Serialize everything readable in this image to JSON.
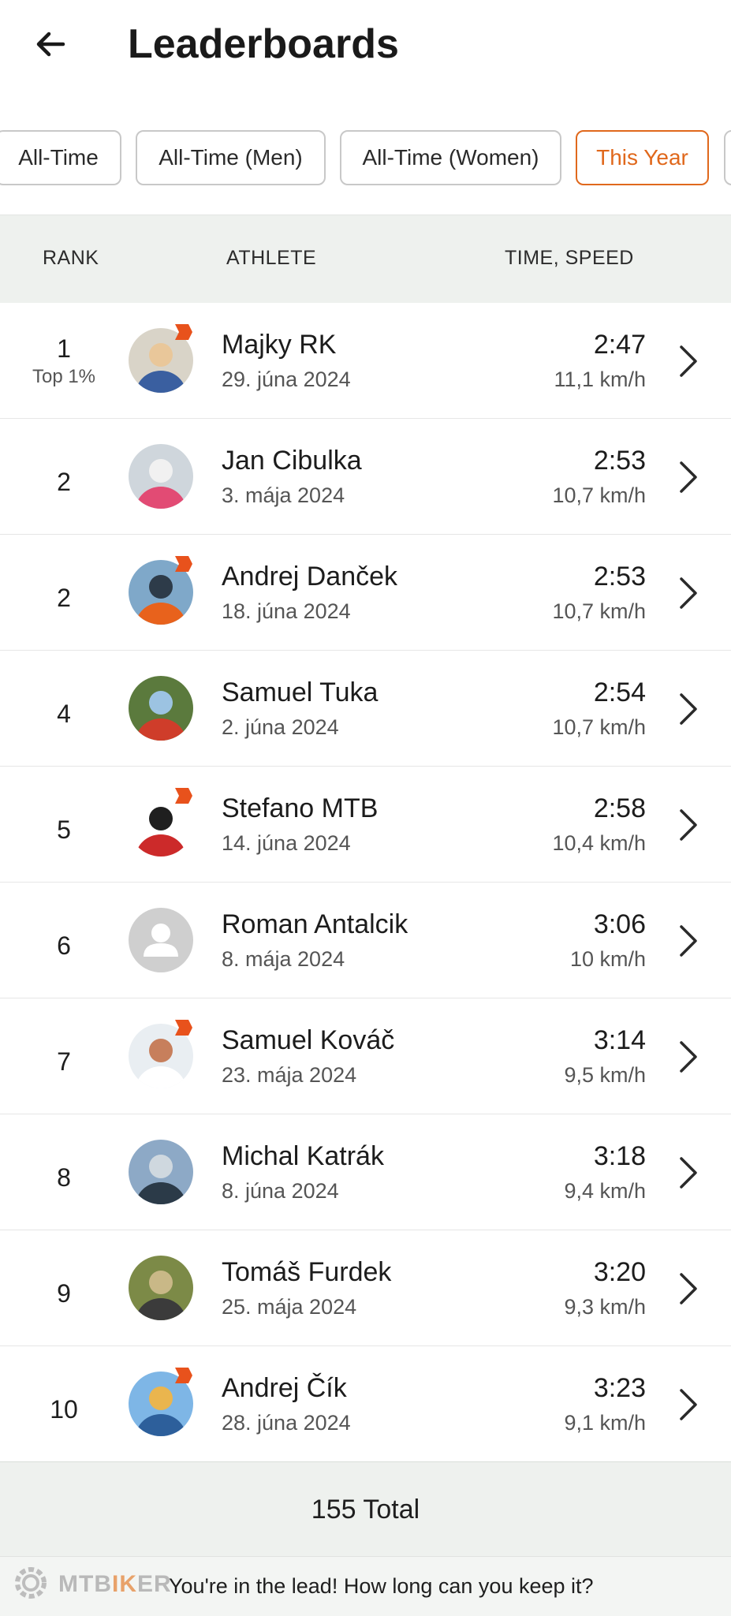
{
  "header": {
    "title": "Leaderboards",
    "back_icon": "arrow-left-icon"
  },
  "filters": [
    {
      "label": "All-Time",
      "active": false
    },
    {
      "label": "All-Time (Men)",
      "active": false
    },
    {
      "label": "All-Time (Women)",
      "active": false
    },
    {
      "label": "This Year",
      "active": true
    }
  ],
  "columns": {
    "rank": "RANK",
    "athlete": "ATHLETE",
    "time_speed": "TIME, SPEED"
  },
  "entries": [
    {
      "rank": "1",
      "rank_sub": "Top 1%",
      "name": "Majky RK",
      "date": "29. júna 2024",
      "time": "2:47",
      "speed": "11,1 km/h",
      "subscriber": true
    },
    {
      "rank": "2",
      "rank_sub": "",
      "name": "Jan Cibulka",
      "date": "3. mája 2024",
      "time": "2:53",
      "speed": "10,7 km/h",
      "subscriber": false
    },
    {
      "rank": "2",
      "rank_sub": "",
      "name": "Andrej Danček",
      "date": "18. júna 2024",
      "time": "2:53",
      "speed": "10,7 km/h",
      "subscriber": true
    },
    {
      "rank": "4",
      "rank_sub": "",
      "name": "Samuel Tuka",
      "date": "2. júna 2024",
      "time": "2:54",
      "speed": "10,7 km/h",
      "subscriber": false
    },
    {
      "rank": "5",
      "rank_sub": "",
      "name": "Stefano MTB",
      "date": "14. júna 2024",
      "time": "2:58",
      "speed": "10,4 km/h",
      "subscriber": true
    },
    {
      "rank": "6",
      "rank_sub": "",
      "name": "Roman Antalcik",
      "date": "8. mája 2024",
      "time": "3:06",
      "speed": "10 km/h",
      "subscriber": false
    },
    {
      "rank": "7",
      "rank_sub": "",
      "name": "Samuel Kováč",
      "date": "23. mája 2024",
      "time": "3:14",
      "speed": "9,5 km/h",
      "subscriber": true
    },
    {
      "rank": "8",
      "rank_sub": "",
      "name": "Michal Katrák",
      "date": "8. júna 2024",
      "time": "3:18",
      "speed": "9,4 km/h",
      "subscriber": false
    },
    {
      "rank": "9",
      "rank_sub": "",
      "name": "Tomáš Furdek",
      "date": "25. mája 2024",
      "time": "3:20",
      "speed": "9,3 km/h",
      "subscriber": false
    },
    {
      "rank": "10",
      "rank_sub": "",
      "name": "Andrej Čík",
      "date": "28. júna 2024",
      "time": "3:23",
      "speed": "9,1 km/h",
      "subscriber": true
    }
  ],
  "total": "155 Total",
  "footer": {
    "message": "You're in the lead!  How long can you keep it?",
    "watermark": "MTBIKER"
  },
  "colors": {
    "accent": "#e0681c",
    "header_bg": "#eef1ee"
  }
}
